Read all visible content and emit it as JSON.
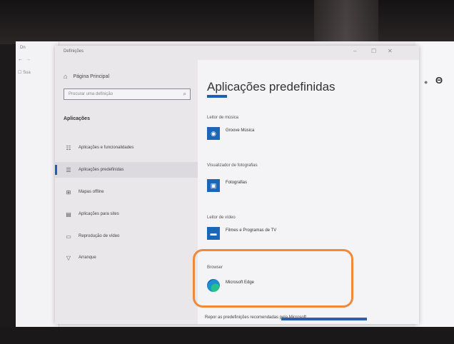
{
  "browser": {
    "tab_text": "Dn",
    "back": "←",
    "forward": "→",
    "fav": "☐ Sua"
  },
  "window": {
    "title": "Definições",
    "minimize": "–",
    "maximize": "☐",
    "close": "✕"
  },
  "sidebar": {
    "home_label": "Página Principal",
    "search_placeholder": "Procurar uma definição",
    "section_title": "Aplicações",
    "items": [
      {
        "icon": "apps-features-icon",
        "glyph": "☷",
        "label": "Aplicações e funcionalidades"
      },
      {
        "icon": "default-apps-icon",
        "glyph": "☰",
        "label": "Aplicações predefinidas"
      },
      {
        "icon": "offline-maps-icon",
        "glyph": "⊞",
        "label": "Mapas offline"
      },
      {
        "icon": "apps-websites-icon",
        "glyph": "▤",
        "label": "Aplicações para sites"
      },
      {
        "icon": "video-playback-icon",
        "glyph": "▭",
        "label": "Reprodução de vídeo"
      },
      {
        "icon": "startup-icon",
        "glyph": "▽",
        "label": "Arranque"
      }
    ]
  },
  "main": {
    "title": "Aplicações predefinidas",
    "sections": [
      {
        "category": "Leitor de música",
        "app": "Groove Música",
        "icon": "groove-music-icon",
        "glyph": "◉"
      },
      {
        "category": "Visualizador de fotografias",
        "app": "Fotografias",
        "icon": "photos-icon",
        "glyph": "▣"
      },
      {
        "category": "Leitor de vídeo",
        "app": "Filmes e Programas de TV",
        "icon": "movies-tv-icon",
        "glyph": "▬"
      },
      {
        "category": "Browser",
        "app": "Microsoft Edge",
        "icon": "edge-icon"
      }
    ],
    "reset_text": "Repor as predefinições recomendadas pela Microsoft"
  },
  "right": {
    "dot": "●",
    "account": "Θ"
  },
  "colors": {
    "accent": "#1a62b5",
    "highlight": "#ef8a3c"
  }
}
